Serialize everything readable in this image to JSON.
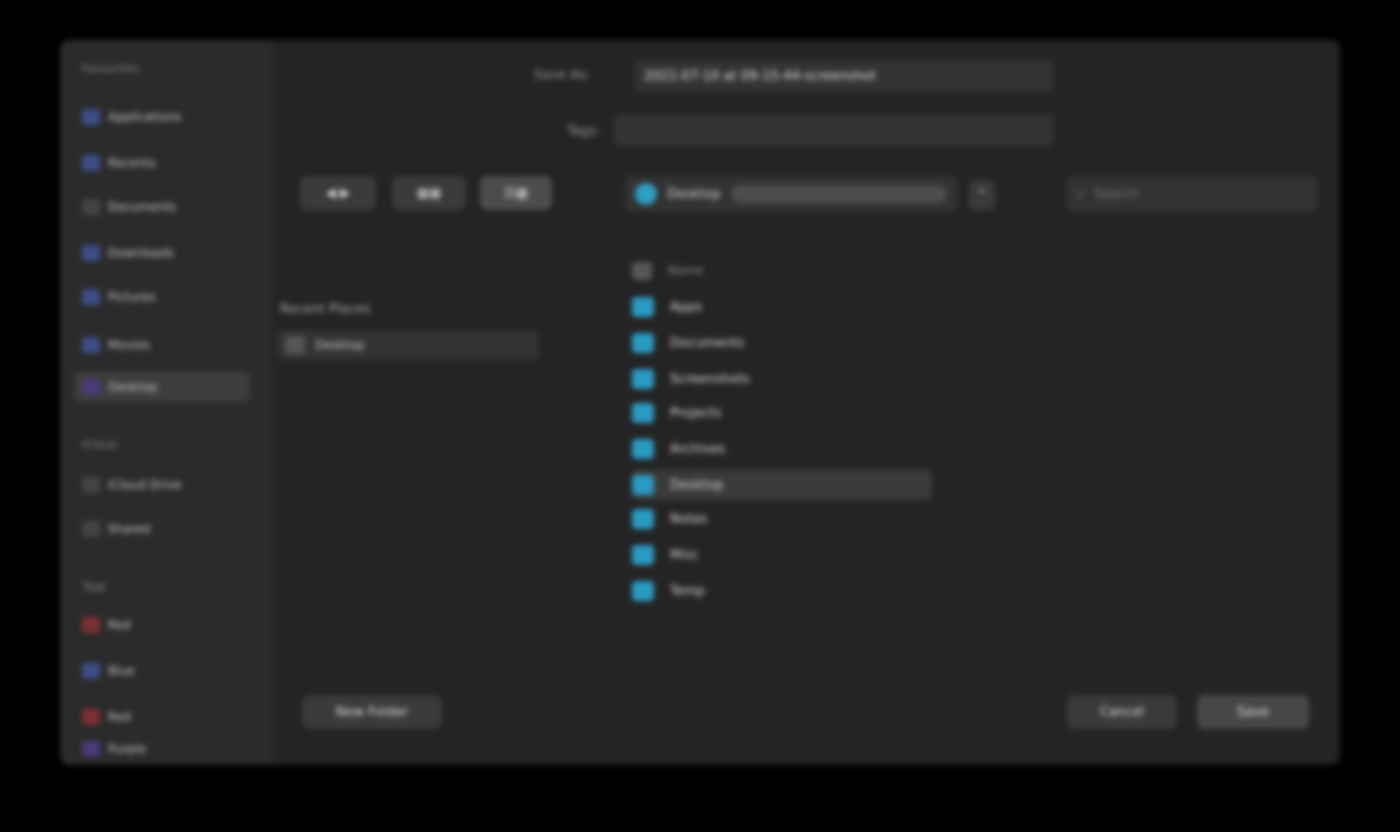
{
  "dialog": {
    "save_as_label": "Save As:",
    "save_as_value": "2021-07-10 at 09-15-44-screenshot",
    "tags_label": "Tags:",
    "tags_value": ""
  },
  "toolbar": {
    "back_label": "◀ ▶",
    "view_grid_label": "▦▦",
    "view_list_label": "☰▦",
    "location": "Desktop",
    "expand_icon": "chevron-up-icon",
    "search_placeholder": "Search"
  },
  "sidebar": {
    "sections": [
      {
        "title": "Favourites",
        "items": [
          {
            "label": "Applications",
            "icon": "apps-icon"
          },
          {
            "label": "Recents",
            "icon": "clock-icon"
          },
          {
            "label": "Documents",
            "icon": "doc-icon"
          },
          {
            "label": "Downloads",
            "icon": "download-icon"
          },
          {
            "label": "Pictures",
            "icon": "pictures-icon"
          },
          {
            "label": "Movies",
            "icon": "movies-icon"
          },
          {
            "label": "Desktop",
            "icon": "desktop-icon",
            "active": true
          }
        ]
      },
      {
        "title": "iCloud",
        "items": [
          {
            "label": "iCloud Drive",
            "icon": "cloud-icon"
          },
          {
            "label": "Shared",
            "icon": "shared-icon"
          }
        ]
      },
      {
        "title": "Tags",
        "items": [
          {
            "label": "Red",
            "icon": "tag-icon"
          },
          {
            "label": "Blue",
            "icon": "tag-icon"
          },
          {
            "label": "Red",
            "icon": "tag-icon"
          },
          {
            "label": "Purple",
            "icon": "tag-icon"
          }
        ]
      }
    ]
  },
  "recent": {
    "label": "Recent Places",
    "item": "Desktop"
  },
  "file_list": {
    "header": "Name",
    "items": [
      {
        "name": "Apps",
        "selected": false
      },
      {
        "name": "Documents",
        "selected": false
      },
      {
        "name": "Screenshots",
        "selected": false
      },
      {
        "name": "Projects",
        "selected": false
      },
      {
        "name": "Archives",
        "selected": false
      },
      {
        "name": "Desktop",
        "selected": true
      },
      {
        "name": "Notes",
        "selected": false
      },
      {
        "name": "Misc",
        "selected": false
      },
      {
        "name": "Temp",
        "selected": false
      }
    ]
  },
  "buttons": {
    "new_folder": "New Folder",
    "cancel": "Cancel",
    "save": "Save"
  }
}
